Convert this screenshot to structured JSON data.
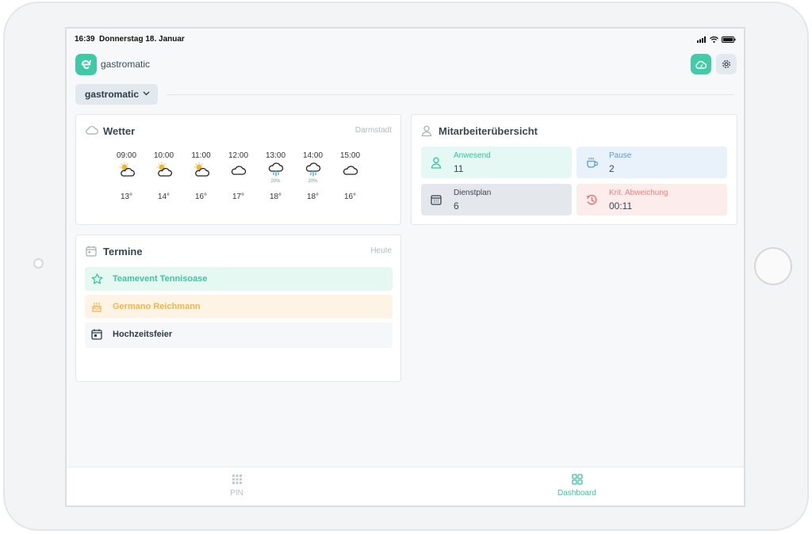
{
  "status_bar": {
    "time": "16:39",
    "date": "Donnerstag 18. Januar"
  },
  "header": {
    "app_name": "gastromatic",
    "logo_icon": "gastromatic-logo-icon",
    "accent": "#43cba8"
  },
  "location_select": {
    "value": "gastromatic"
  },
  "weather": {
    "title": "Wetter",
    "location": "Darmstadt",
    "forecast": [
      {
        "time": "09:00",
        "icon": "partly-sunny-icon",
        "precip": "",
        "temp": "13°"
      },
      {
        "time": "10:00",
        "icon": "partly-sunny-icon",
        "precip": "",
        "temp": "14°"
      },
      {
        "time": "11:00",
        "icon": "partly-sunny-icon",
        "precip": "",
        "temp": "16°"
      },
      {
        "time": "12:00",
        "icon": "cloud-icon",
        "precip": "",
        "temp": "17°"
      },
      {
        "time": "13:00",
        "icon": "rain-icon",
        "precip": "20%",
        "temp": "18°"
      },
      {
        "time": "14:00",
        "icon": "rain-icon",
        "precip": "20%",
        "temp": "18°"
      },
      {
        "time": "15:00",
        "icon": "cloud-icon",
        "precip": "",
        "temp": "16°"
      }
    ]
  },
  "staff": {
    "title": "Mitarbeiterübersicht",
    "tiles": [
      {
        "label": "Anwesend",
        "value": "11",
        "icon": "person-icon"
      },
      {
        "label": "Pause",
        "value": "2",
        "icon": "coffee-cup-icon"
      },
      {
        "label": "Dienstplan",
        "value": "6",
        "icon": "calendar-grid-icon"
      },
      {
        "label": "Krit. Abweichung",
        "value": "00:11",
        "icon": "clock-alert-icon"
      }
    ]
  },
  "events": {
    "title": "Termine",
    "filter": "Heute",
    "items": [
      {
        "label": "Teamevent Tennisoase",
        "icon": "star-icon"
      },
      {
        "label": "Germano Reichmann",
        "icon": "birthday-cake-icon"
      },
      {
        "label": "Hochzeitsfeier",
        "icon": "calendar-event-icon"
      }
    ]
  },
  "tabbar": {
    "pin_label": "PIN",
    "dashboard_label": "Dashboard",
    "active": "Dashboard"
  }
}
